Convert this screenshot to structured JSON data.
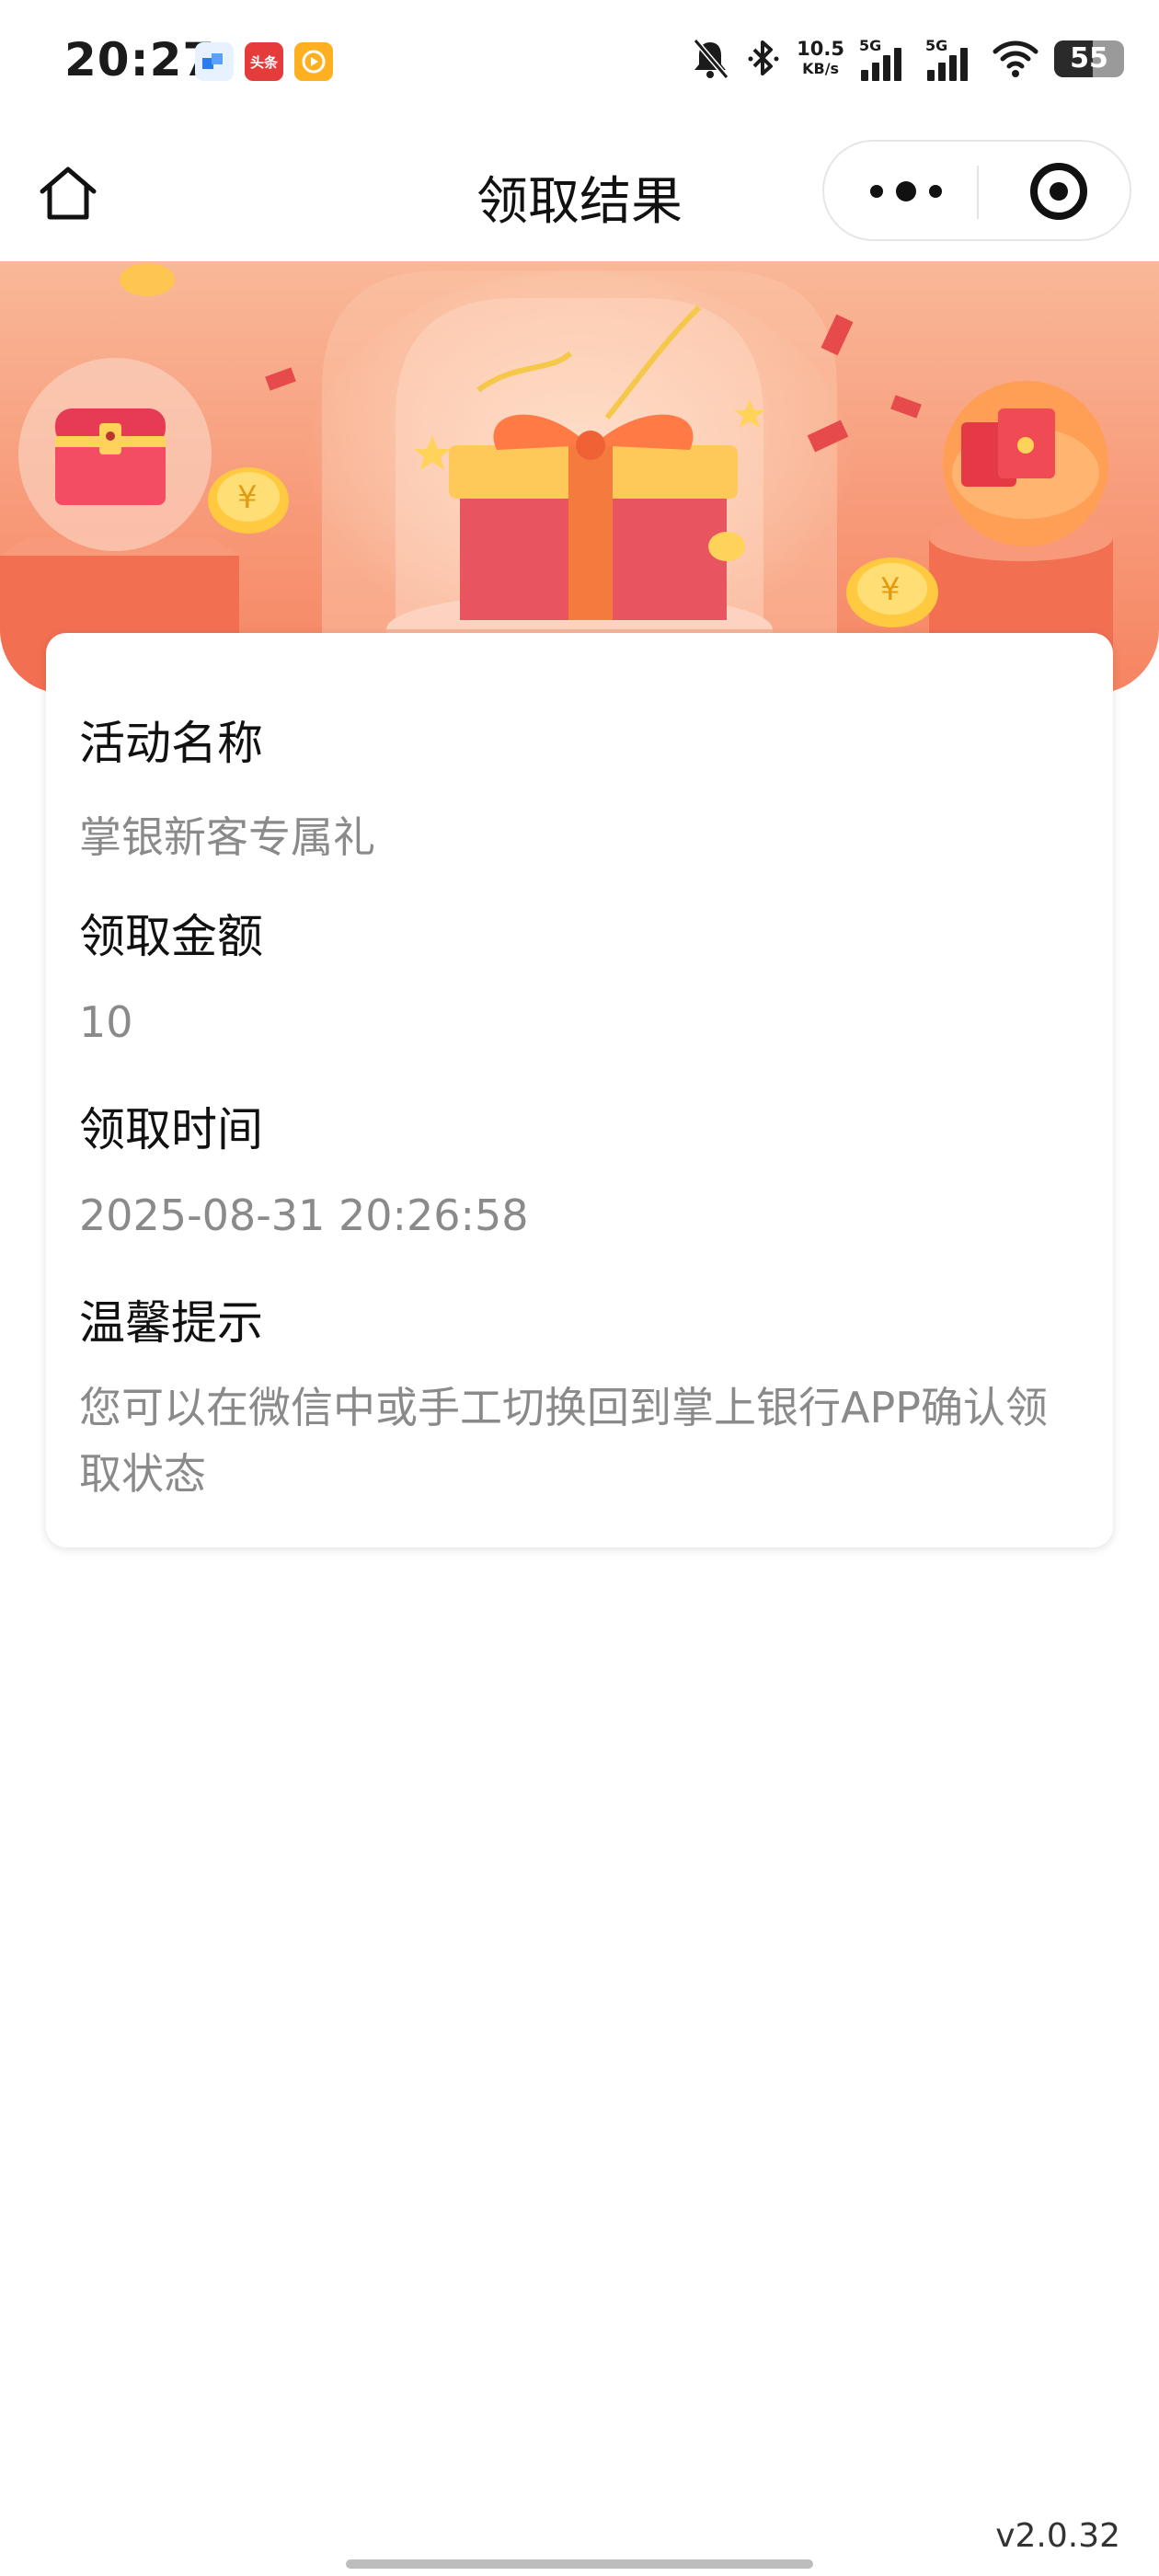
{
  "status_bar": {
    "time": "20:27",
    "app_icons": [
      {
        "name": "app-blue",
        "label": ""
      },
      {
        "name": "toutiao-app",
        "label": "头条"
      },
      {
        "name": "video-app",
        "label": ""
      }
    ],
    "net_speed_value": "10.5",
    "net_speed_unit": "KB/s",
    "signal_1_label": "5G",
    "signal_2_label": "5G",
    "battery_level": "55",
    "icons": [
      "mute-bell-icon",
      "bluetooth-icon",
      "signal-icon",
      "wifi-icon",
      "battery-icon"
    ]
  },
  "nav": {
    "title": "领取结果",
    "home_icon": "home-icon",
    "more_icon": "more-dots-icon",
    "close_icon": "target-close-icon"
  },
  "banner": {
    "colors": {
      "bg_top": "#f7a67f",
      "bg_bottom": "#f68865",
      "accent": "#ffd24a",
      "gift": "#e8545f"
    }
  },
  "card": {
    "fields": [
      {
        "label": "活动名称",
        "value": "掌银新客专属礼"
      },
      {
        "label": "领取金额",
        "value": "10"
      },
      {
        "label": "领取时间",
        "value": "2025-08-31 20:26:58"
      },
      {
        "label": "温馨提示",
        "value": "您可以在微信中或手工切换回到掌上银行APP确认领取状态"
      }
    ]
  },
  "footer": {
    "version": "v2.0.32"
  }
}
